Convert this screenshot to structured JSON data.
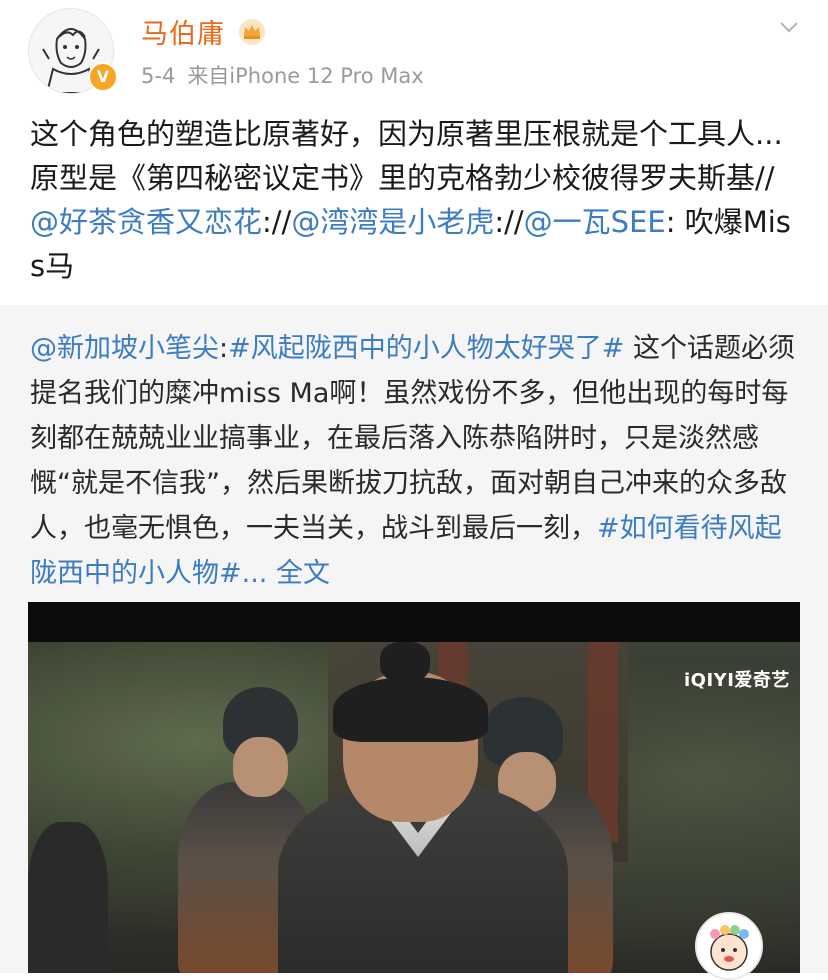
{
  "author": {
    "name": "马伯庸",
    "verified_badge": "V",
    "avatar_icon": "sketch-portrait-avatar",
    "crown_icon": "gold-crown-icon"
  },
  "meta": {
    "date": "5-4",
    "source": "来自iPhone 12 Pro Max"
  },
  "post": {
    "t1": "这个角色的塑造比原著好，因为原著里压根就是个工具人...原型是《第四秘密议定书》里的克格勃少校彼得罗夫斯基//",
    "m1": "@好茶贪香又恋花",
    "t2": "://",
    "m2": "@湾湾是小老虎",
    "t3": "://",
    "m3": "@一瓦SEE",
    "t4": ": 吹爆Miss马"
  },
  "repost": {
    "m1": "@新加坡小笔尖",
    "t1": ":",
    "tag1": "#风起陇西中的小人物太好哭了#",
    "t2": " 这个话题必须提名我们的糜冲miss Ma啊！虽然戏份不多，但他出现的每时每刻都在兢兢业业搞事业，在最后落入陈恭陷阱时，只是淡然感慨“就是不信我”，然后果断拔刀抗敌，面对朝自己冲来的众多敌人，也毫无惧色，一夫当关，战斗到最后一刻，",
    "tag2": "#如何看待风起陇西中的小人物#",
    "more": "... 全文"
  },
  "video": {
    "watermark": "iQIYI爱奇艺"
  },
  "colors": {
    "username": "#e86b1c",
    "link": "#3b7cc4",
    "meta": "#9a9a9a",
    "repost_bg": "#f5f5f5"
  }
}
